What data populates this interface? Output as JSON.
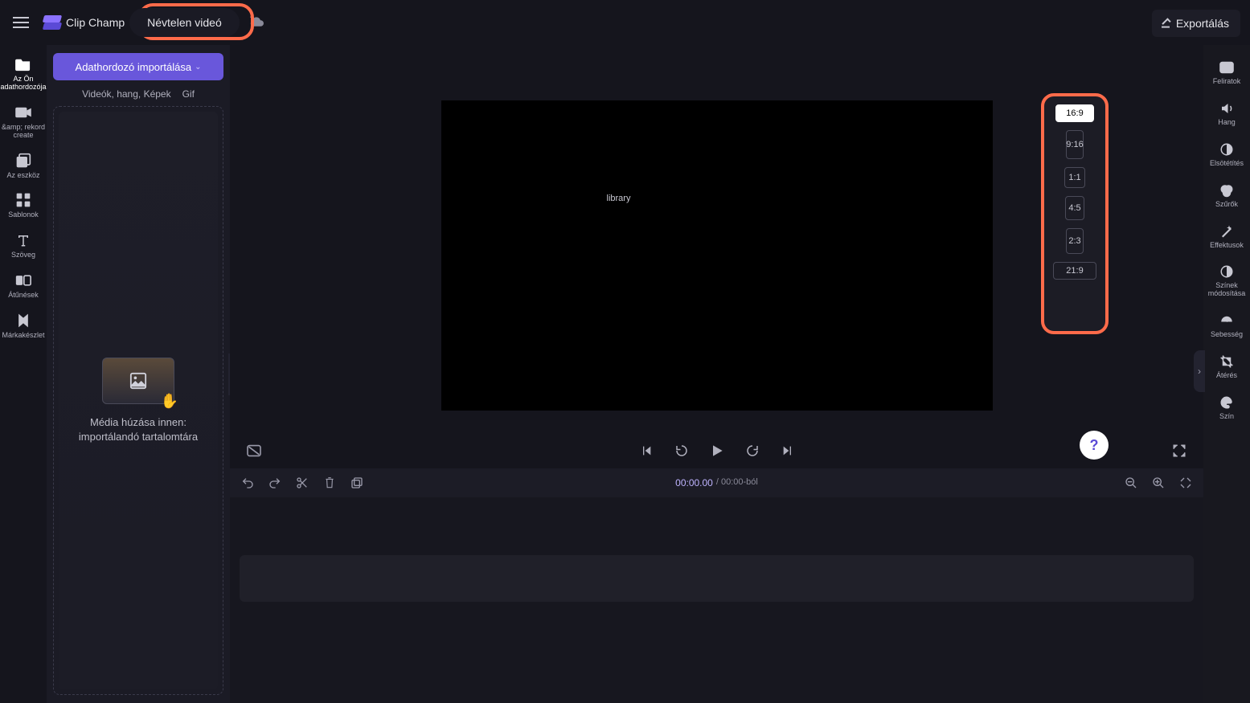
{
  "header": {
    "app_name": "Clip Champ",
    "project_title": "Névtelen videó",
    "export_label": "Exportálás"
  },
  "sidebar_left": {
    "items": [
      {
        "id": "media",
        "label": "Az Ön adathordozója"
      },
      {
        "id": "record",
        "label": "&amp; rekord\ncreate"
      },
      {
        "id": "tools",
        "label": "Az eszköz"
      },
      {
        "id": "templates",
        "label": "Sablonok"
      },
      {
        "id": "text",
        "label": "Szöveg"
      },
      {
        "id": "transitions",
        "label": "Átűnések"
      },
      {
        "id": "brandkit",
        "label": "Márkakészlet"
      }
    ]
  },
  "media_panel": {
    "import_label": "Adathordozó importálása",
    "sub_left": "Videók, hang, Képek",
    "sub_right": "Gif",
    "drop_line1": "Média húzása innen:",
    "drop_line2": "importálandó tartalomtára"
  },
  "preview": {
    "overlay_text": "library"
  },
  "player": {
    "current_time": "00:00.00",
    "total_label": "/ 00:00-ból"
  },
  "aspect_ratios": {
    "items": [
      {
        "label": "16:9",
        "key": "16-9",
        "active": true
      },
      {
        "label": "9:16",
        "key": "9-16",
        "active": false
      },
      {
        "label": "1:1",
        "key": "1-1",
        "active": false
      },
      {
        "label": "4:5",
        "key": "4-5",
        "active": false
      },
      {
        "label": "2:3",
        "key": "2-3",
        "active": false
      },
      {
        "label": "21:9",
        "key": "21-9",
        "active": false
      }
    ]
  },
  "sidebar_right": {
    "items": [
      {
        "id": "captions",
        "label": "Feliratok"
      },
      {
        "id": "audio",
        "label": "Hang"
      },
      {
        "id": "fade",
        "label": "Elsötétítés"
      },
      {
        "id": "filters",
        "label": "Szűrők"
      },
      {
        "id": "effects",
        "label": "Effektusok"
      },
      {
        "id": "adjust",
        "label": "Színek\nmódosítása"
      },
      {
        "id": "speed",
        "label": "Sebesség"
      },
      {
        "id": "transform",
        "label": "Átérés"
      },
      {
        "id": "color",
        "label": "Szín"
      }
    ]
  },
  "help": {
    "label": "?"
  }
}
